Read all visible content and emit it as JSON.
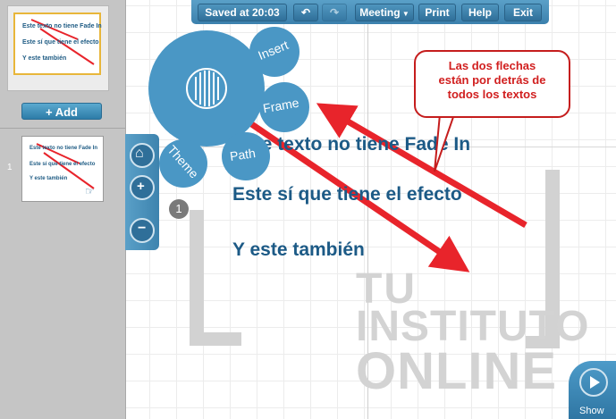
{
  "sidebar": {
    "thumbnail_1_lines": [
      "Este texto no tiene Fade In",
      "Este sí que tiene el efecto",
      "Y este también"
    ],
    "add_button_label": "Add",
    "slide_number": "1",
    "thumbnail_2_lines": [
      "Este texto no tiene Fade In",
      "Este sí que tiene el efecto",
      "Y este también"
    ]
  },
  "toolbar": {
    "saved_label": "Saved at 20:03",
    "meeting_label": "Meeting",
    "print_label": "Print",
    "help_label": "Help",
    "exit_label": "Exit"
  },
  "zebra": {
    "insert_label": "Insert",
    "frame_label": "Frame",
    "path_label": "Path",
    "theme_label": "Theme"
  },
  "canvas": {
    "line_1": "Este texto no tiene Fade In",
    "line_2": "Este sí que tiene el efecto",
    "line_3": "Y este también",
    "path_step_number": "1"
  },
  "callout": {
    "text_lines": [
      "Las dos flechas",
      "están por detrás de",
      "todos los textos"
    ]
  },
  "watermark": {
    "line_1": "TU",
    "line_2": "INSTITUTO",
    "line_3": "ONLINE"
  },
  "show_button_label": "Show",
  "colors": {
    "accent_blue": "#4a97c5",
    "text_blue": "#1c5a86",
    "arrow_red": "#e8242b",
    "frame_highlight": "#e8b63a"
  }
}
